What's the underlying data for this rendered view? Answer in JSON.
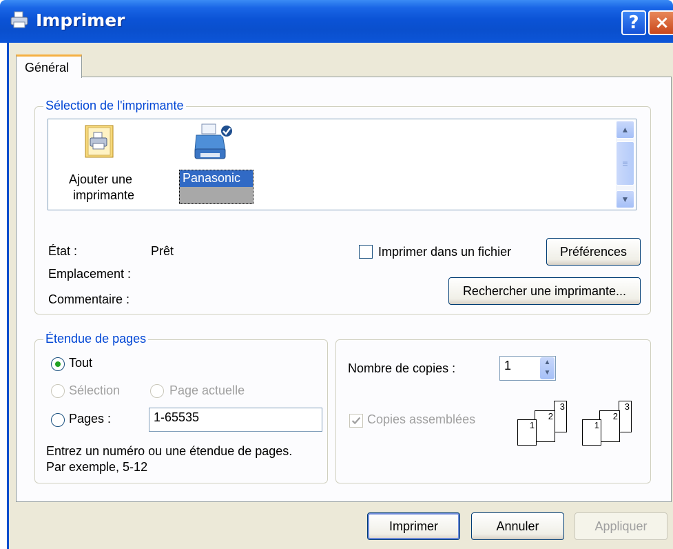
{
  "window": {
    "title": "Imprimer",
    "help_label": "?",
    "close_label": "×"
  },
  "tabs": [
    {
      "label": "Général"
    }
  ],
  "printer_group": {
    "legend": "Sélection de l'imprimante",
    "printers": [
      {
        "name": "Ajouter une imprimante",
        "line1": "Ajouter une",
        "line2": "imprimante"
      },
      {
        "name": "Panasonic",
        "line1": "Panasonic",
        "selected": true
      }
    ],
    "status_label": "État :",
    "status_value": "Prêt",
    "location_label": "Emplacement :",
    "comment_label": "Commentaire :",
    "print_to_file_label": "Imprimer dans un fichier",
    "print_to_file_checked": false,
    "preferences_label": "Préférences",
    "find_printer_label": "Rechercher une imprimante..."
  },
  "page_range": {
    "legend": "Étendue de pages",
    "all_label": "Tout",
    "selection_label": "Sélection",
    "current_page_label": "Page actuelle",
    "pages_label": "Pages :",
    "pages_value": "1-65535",
    "hint_line1": "Entrez un numéro ou une étendue de pages.",
    "hint_line2": "Par exemple, 5-12",
    "selected": "all"
  },
  "copies": {
    "count_label": "Nombre de copies :",
    "count_value": "1",
    "collate_label": "Copies assemblées",
    "collate_checked": true,
    "sheet_numbers": [
      "1",
      "2",
      "3"
    ]
  },
  "buttons": {
    "print": "Imprimer",
    "cancel": "Annuler",
    "apply": "Appliquer"
  },
  "colors": {
    "titlebar": "#0a4fcd",
    "legend_text": "#0046d5",
    "selection": "#316ac5",
    "dialog_bg": "#ece9d8"
  }
}
